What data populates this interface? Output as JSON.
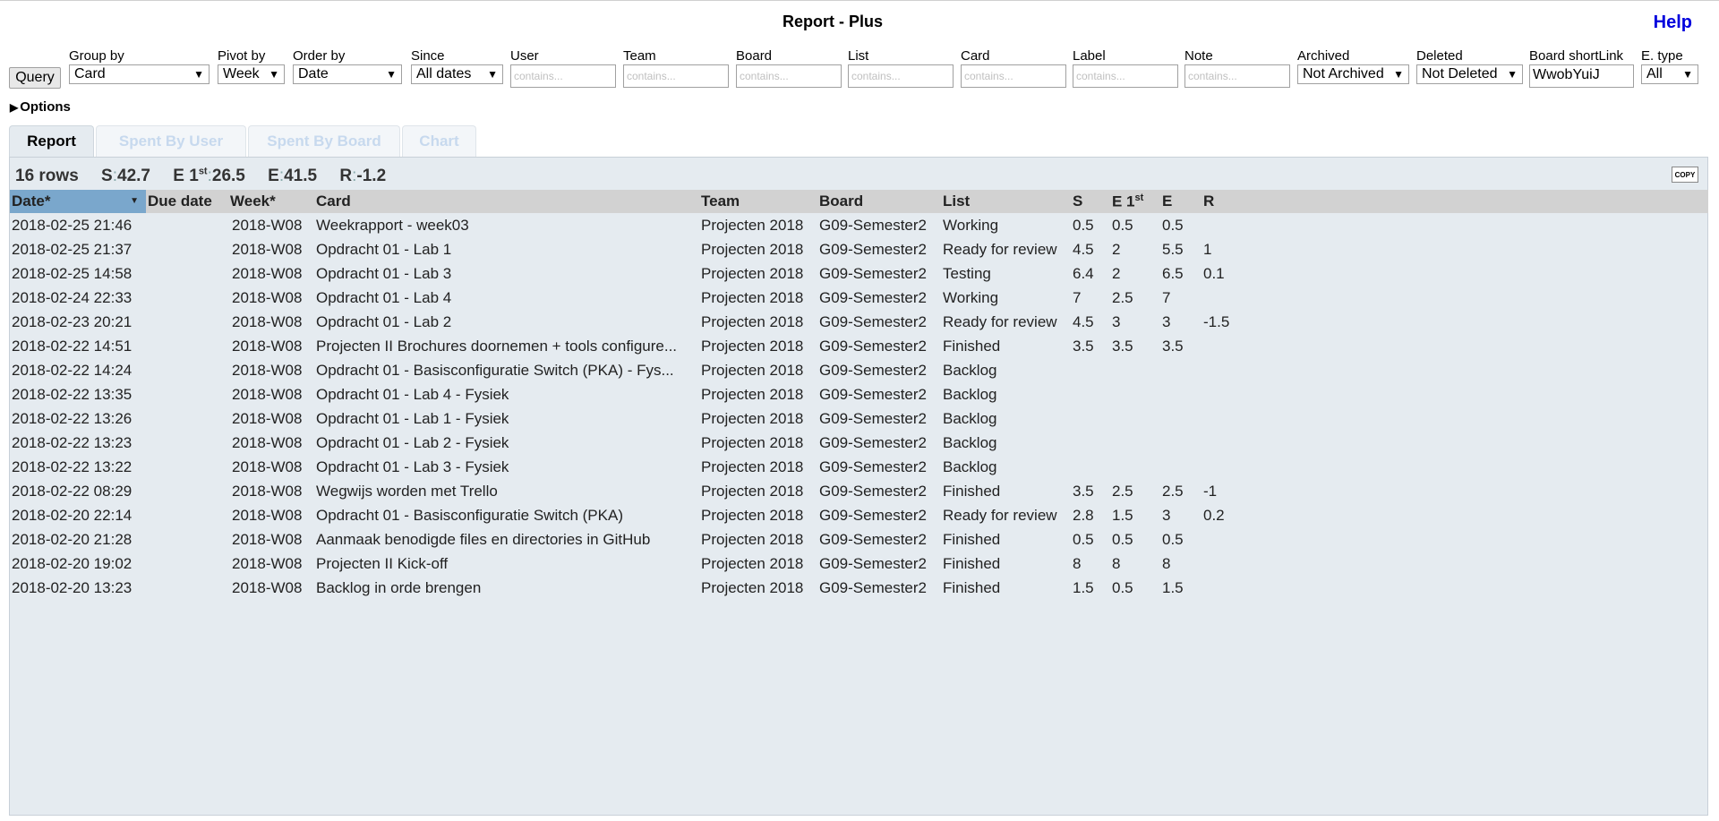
{
  "header": {
    "title": "Report - Plus",
    "help": "Help"
  },
  "query_button": "Query",
  "filters": {
    "group_by": {
      "label": "Group by",
      "value": "Card"
    },
    "pivot_by": {
      "label": "Pivot by",
      "value": "Week"
    },
    "order_by": {
      "label": "Order by",
      "value": "Date"
    },
    "since": {
      "label": "Since",
      "value": "All dates"
    },
    "user": {
      "label": "User",
      "placeholder": "contains..."
    },
    "team": {
      "label": "Team",
      "placeholder": "contains..."
    },
    "board": {
      "label": "Board",
      "placeholder": "contains..."
    },
    "list": {
      "label": "List",
      "placeholder": "contains..."
    },
    "card": {
      "label": "Card",
      "placeholder": "contains..."
    },
    "label": {
      "label": "Label",
      "placeholder": "contains..."
    },
    "note": {
      "label": "Note",
      "placeholder": "contains..."
    },
    "archived": {
      "label": "Archived",
      "value": "Not Archived"
    },
    "deleted": {
      "label": "Deleted",
      "value": "Not Deleted"
    },
    "board_shortlink": {
      "label": "Board shortLink",
      "value": "WwobYuiJ"
    },
    "e_type": {
      "label": "E. type",
      "value": "All"
    }
  },
  "options_label": "Options",
  "tabs": [
    {
      "label": "Report",
      "active": true
    },
    {
      "label": "Spent By User",
      "active": false
    },
    {
      "label": "Spent By Board",
      "active": false
    },
    {
      "label": "Chart",
      "active": false
    }
  ],
  "summary": {
    "rows": "16 rows",
    "s_label": "S",
    "s_value": "42.7",
    "e1_label": "E 1",
    "e1_sup": "st",
    "e1_value": "26.5",
    "e_label": "E",
    "e_value": "41.5",
    "r_label": "R",
    "r_value": "-1.2"
  },
  "copy_icon": "COPY",
  "table": {
    "headers": {
      "date": "Date*",
      "due": "Due date",
      "week": "Week*",
      "card": "Card",
      "team": "Team",
      "board": "Board",
      "list": "List",
      "s": "S",
      "e1": "E 1",
      "e1_sup": "st",
      "e": "E",
      "r": "R"
    },
    "rows": [
      {
        "date": "2018-02-25 21:46",
        "due": "",
        "week": "2018-W08",
        "card": "Weekrapport - week03",
        "team": "Projecten 2018",
        "board": "G09-Semester2",
        "list": "Working",
        "s": "0.5",
        "e1": "0.5",
        "e": "0.5",
        "r": ""
      },
      {
        "date": "2018-02-25 21:37",
        "due": "",
        "week": "2018-W08",
        "card": "Opdracht 01 - Lab 1",
        "team": "Projecten 2018",
        "board": "G09-Semester2",
        "list": "Ready for review",
        "s": "4.5",
        "e1": "2",
        "e": "5.5",
        "r": "1"
      },
      {
        "date": "2018-02-25 14:58",
        "due": "",
        "week": "2018-W08",
        "card": "Opdracht 01 - Lab 3",
        "team": "Projecten 2018",
        "board": "G09-Semester2",
        "list": "Testing",
        "s": "6.4",
        "e1": "2",
        "e": "6.5",
        "r": "0.1"
      },
      {
        "date": "2018-02-24 22:33",
        "due": "",
        "week": "2018-W08",
        "card": "Opdracht 01 - Lab 4",
        "team": "Projecten 2018",
        "board": "G09-Semester2",
        "list": "Working",
        "s": "7",
        "e1": "2.5",
        "e": "7",
        "r": ""
      },
      {
        "date": "2018-02-23 20:21",
        "due": "",
        "week": "2018-W08",
        "card": "Opdracht 01 - Lab 2",
        "team": "Projecten 2018",
        "board": "G09-Semester2",
        "list": "Ready for review",
        "s": "4.5",
        "e1": "3",
        "e": "3",
        "r": "-1.5"
      },
      {
        "date": "2018-02-22 14:51",
        "due": "",
        "week": "2018-W08",
        "card": "Projecten II Brochures doornemen + tools configure...",
        "team": "Projecten 2018",
        "board": "G09-Semester2",
        "list": "Finished",
        "s": "3.5",
        "e1": "3.5",
        "e": "3.5",
        "r": ""
      },
      {
        "date": "2018-02-22 14:24",
        "due": "",
        "week": "2018-W08",
        "card": "Opdracht 01 - Basisconfiguratie Switch (PKA) - Fys...",
        "team": "Projecten 2018",
        "board": "G09-Semester2",
        "list": "Backlog",
        "s": "",
        "e1": "",
        "e": "",
        "r": ""
      },
      {
        "date": "2018-02-22 13:35",
        "due": "",
        "week": "2018-W08",
        "card": "Opdracht 01 - Lab 4 - Fysiek",
        "team": "Projecten 2018",
        "board": "G09-Semester2",
        "list": "Backlog",
        "s": "",
        "e1": "",
        "e": "",
        "r": ""
      },
      {
        "date": "2018-02-22 13:26",
        "due": "",
        "week": "2018-W08",
        "card": "Opdracht 01 - Lab 1 - Fysiek",
        "team": "Projecten 2018",
        "board": "G09-Semester2",
        "list": "Backlog",
        "s": "",
        "e1": "",
        "e": "",
        "r": ""
      },
      {
        "date": "2018-02-22 13:23",
        "due": "",
        "week": "2018-W08",
        "card": "Opdracht 01 - Lab 2 - Fysiek",
        "team": "Projecten 2018",
        "board": "G09-Semester2",
        "list": "Backlog",
        "s": "",
        "e1": "",
        "e": "",
        "r": ""
      },
      {
        "date": "2018-02-22 13:22",
        "due": "",
        "week": "2018-W08",
        "card": "Opdracht 01 - Lab 3 - Fysiek",
        "team": "Projecten 2018",
        "board": "G09-Semester2",
        "list": "Backlog",
        "s": "",
        "e1": "",
        "e": "",
        "r": ""
      },
      {
        "date": "2018-02-22 08:29",
        "due": "",
        "week": "2018-W08",
        "card": "Wegwijs worden met Trello",
        "team": "Projecten 2018",
        "board": "G09-Semester2",
        "list": "Finished",
        "s": "3.5",
        "e1": "2.5",
        "e": "2.5",
        "r": "-1"
      },
      {
        "date": "2018-02-20 22:14",
        "due": "",
        "week": "2018-W08",
        "card": "Opdracht 01 - Basisconfiguratie Switch (PKA)",
        "team": "Projecten 2018",
        "board": "G09-Semester2",
        "list": "Ready for review",
        "s": "2.8",
        "e1": "1.5",
        "e": "3",
        "r": "0.2"
      },
      {
        "date": "2018-02-20 21:28",
        "due": "",
        "week": "2018-W08",
        "card": "Aanmaak benodigde files en directories in GitHub",
        "team": "Projecten 2018",
        "board": "G09-Semester2",
        "list": "Finished",
        "s": "0.5",
        "e1": "0.5",
        "e": "0.5",
        "r": ""
      },
      {
        "date": "2018-02-20 19:02",
        "due": "",
        "week": "2018-W08",
        "card": "Projecten II Kick-off",
        "team": "Projecten 2018",
        "board": "G09-Semester2",
        "list": "Finished",
        "s": "8",
        "e1": "8",
        "e": "8",
        "r": ""
      },
      {
        "date": "2018-02-20 13:23",
        "due": "",
        "week": "2018-W08",
        "card": "Backlog in orde brengen",
        "team": "Projecten 2018",
        "board": "G09-Semester2",
        "list": "Finished",
        "s": "1.5",
        "e1": "0.5",
        "e": "1.5",
        "r": ""
      }
    ]
  }
}
